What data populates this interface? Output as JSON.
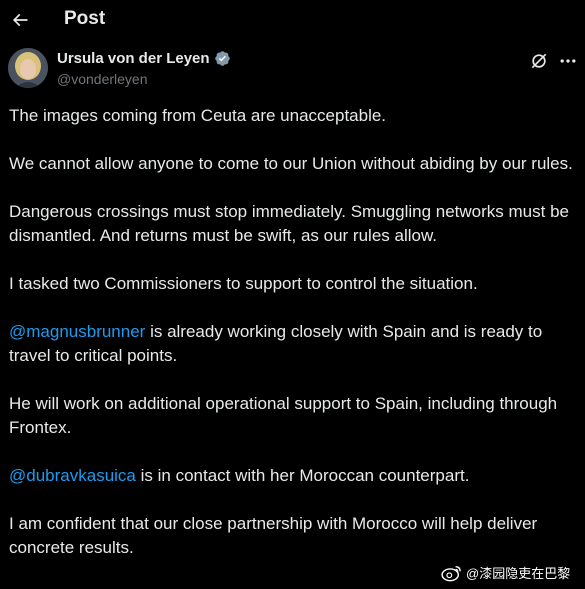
{
  "header": {
    "back_icon": "arrow-left-icon",
    "title": "Post"
  },
  "author": {
    "display_name": "Ursula von der Leyen",
    "handle": "@vonderleyen",
    "verified_icon": "verified-badge-icon",
    "grok_icon": "grok-slash-icon",
    "more_icon": "more-dots-icon"
  },
  "tweet": {
    "p1": "The images coming from Ceuta are unacceptable.",
    "p2": "We cannot allow anyone to come to our Union without abiding by our rules.",
    "p3": "Dangerous crossings must stop immediately. Smuggling networks must be dismantled. And returns must be swift, as our rules allow.",
    "p4": "I tasked two Commissioners to support to control the situation.",
    "p5_mention": "@magnusbrunner",
    "p5_rest": " is already working closely with Spain and is ready to travel to critical points.",
    "p6": "He will work on additional operational support to Spain, including through Frontex.",
    "p7_mention": "@dubravkasuica",
    "p7_rest": " is in contact with her Moroccan counterpart.",
    "p8": "I am confident that our close partnership with Morocco will help deliver concrete results."
  },
  "watermark": {
    "icon": "weibo-logo-icon",
    "text": "@漆园隐吏在巴黎"
  },
  "colors": {
    "background": "#000000",
    "text": "#e7e9ea",
    "secondary": "#71767b",
    "accent": "#1d9bf0"
  }
}
